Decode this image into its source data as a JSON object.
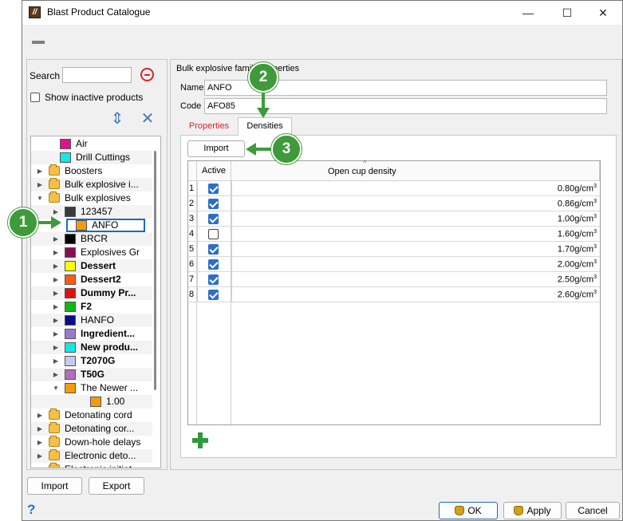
{
  "window": {
    "title": "Blast Product Catalogue",
    "minimize": "—",
    "maximize": "☐",
    "close": "✕"
  },
  "search": {
    "label": "Search",
    "value": "",
    "show_inactive_label": "Show inactive products",
    "show_inactive_checked": false
  },
  "tree": [
    {
      "label": "Air",
      "kind": "swatch",
      "color": "#e0128a",
      "expand": "",
      "bold": false
    },
    {
      "label": "Drill Cuttings",
      "kind": "swatch",
      "color": "#12e8e8",
      "expand": "",
      "bold": false
    },
    {
      "label": "Boosters",
      "kind": "folder",
      "expand": "▶",
      "bold": false
    },
    {
      "label": "Bulk explosive i...",
      "kind": "folder",
      "expand": "▶",
      "bold": false
    },
    {
      "label": "Bulk explosives",
      "kind": "folder",
      "expand": "▼",
      "bold": false
    },
    {
      "label": "123457",
      "kind": "swatch",
      "color": "#3a3a3a",
      "expand": "▶",
      "bold": false
    },
    {
      "label": "ANFO",
      "kind": "swatch",
      "color": "#f59b0a",
      "expand": "",
      "bold": false
    },
    {
      "label": "BRCR",
      "kind": "swatch",
      "color": "#000000",
      "expand": "▶",
      "bold": false
    },
    {
      "label": "Explosives Gr",
      "kind": "swatch",
      "color": "#8a0f4f",
      "expand": "▶",
      "bold": false
    },
    {
      "label": "Dessert",
      "kind": "swatch",
      "color": "#ffff00",
      "expand": "▶",
      "bold": true
    },
    {
      "label": "Dessert2",
      "kind": "swatch",
      "color": "#ff5a14",
      "expand": "▶",
      "bold": true
    },
    {
      "label": "Dummy Pr...",
      "kind": "swatch",
      "color": "#e01010",
      "expand": "▶",
      "bold": true
    },
    {
      "label": "F2",
      "kind": "swatch",
      "color": "#10b810",
      "expand": "▶",
      "bold": true
    },
    {
      "label": "HANFO",
      "kind": "swatch",
      "color": "#0a0a8a",
      "expand": "▶",
      "bold": false
    },
    {
      "label": "Ingredient...",
      "kind": "swatch",
      "color": "#9a7ad0",
      "expand": "▶",
      "bold": true
    },
    {
      "label": "New produ...",
      "kind": "swatch",
      "color": "#12e8e8",
      "expand": "▶",
      "bold": true
    },
    {
      "label": "T2070G",
      "kind": "swatch",
      "color": "#c8c8f0",
      "expand": "▶",
      "bold": true
    },
    {
      "label": "T50G",
      "kind": "swatch",
      "color": "#b070b8",
      "expand": "▶",
      "bold": true
    },
    {
      "label": "The Newer ...",
      "kind": "swatch",
      "color": "#f59b0a",
      "expand": "▼",
      "bold": false
    },
    {
      "label": "1.00",
      "kind": "swatch",
      "color": "#f59b0a",
      "expand": "",
      "bold": false
    },
    {
      "label": "Detonating cord",
      "kind": "folder",
      "expand": "▶",
      "bold": false
    },
    {
      "label": "Detonating cor...",
      "kind": "folder",
      "expand": "▶",
      "bold": false
    },
    {
      "label": "Down-hole delays",
      "kind": "folder",
      "expand": "▶",
      "bold": false
    },
    {
      "label": "Electronic deto...",
      "kind": "folder",
      "expand": "▶",
      "bold": false
    },
    {
      "label": "Electronic initiat...",
      "kind": "folder",
      "expand": "▶",
      "bold": false
    }
  ],
  "left_buttons": {
    "import": "Import",
    "export": "Export"
  },
  "family": {
    "title": "Bulk explosive family properties",
    "name_label": "Name",
    "name_value": "ANFO",
    "code_label": "Code",
    "code_value": "AFO85",
    "tabs": [
      "Properties",
      "Densities"
    ],
    "import_label": "Import"
  },
  "densities": {
    "col_active": "Active",
    "col_density": "Open cup density",
    "sort_indicator": "^",
    "unit": "g/cm",
    "unit_exp": "3",
    "rows": [
      {
        "num": "1",
        "active": true,
        "value": "0.80"
      },
      {
        "num": "2",
        "active": true,
        "value": "0.86"
      },
      {
        "num": "3",
        "active": true,
        "value": "1.00"
      },
      {
        "num": "4",
        "active": false,
        "value": "1.60"
      },
      {
        "num": "5",
        "active": true,
        "value": "1.70"
      },
      {
        "num": "6",
        "active": true,
        "value": "2.00"
      },
      {
        "num": "7",
        "active": true,
        "value": "2.50"
      },
      {
        "num": "8",
        "active": true,
        "value": "2.60"
      }
    ]
  },
  "footer": {
    "help": "?",
    "ok": "OK",
    "apply": "Apply",
    "cancel": "Cancel"
  },
  "callouts": [
    "1",
    "2",
    "3"
  ],
  "colors": {
    "callout": "#3f9a3a",
    "accent": "#2c6fc7",
    "tab_inactive": "#d8242b"
  }
}
